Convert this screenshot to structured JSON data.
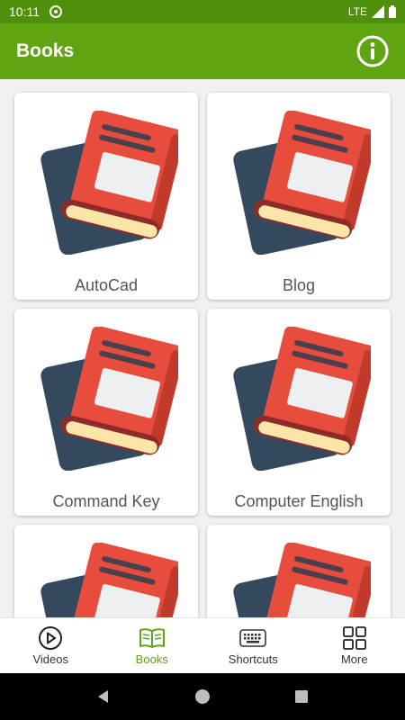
{
  "status": {
    "time": "10:11",
    "network": "LTE"
  },
  "app": {
    "title": "Books"
  },
  "books": [
    {
      "label": "AutoCad",
      "icon": "book-icon"
    },
    {
      "label": "Blog",
      "icon": "book-icon"
    },
    {
      "label": "Command Key",
      "icon": "book-icon"
    },
    {
      "label": "Computer English",
      "icon": "book-icon"
    },
    {
      "label": "",
      "icon": "book-icon"
    },
    {
      "label": "",
      "icon": "book-icon"
    }
  ],
  "nav": {
    "items": [
      {
        "label": "Videos",
        "icon": "play-circle-icon"
      },
      {
        "label": "Books",
        "icon": "open-book-icon",
        "active": true
      },
      {
        "label": "Shortcuts",
        "icon": "keyboard-icon"
      },
      {
        "label": "More",
        "icon": "grid-icon"
      }
    ]
  },
  "colors": {
    "status_bar": "#4f8f0a",
    "app_bar": "#5fa511",
    "active_nav": "#5fa511",
    "book_red": "#e74c3c",
    "book_dark": "#34495e"
  }
}
